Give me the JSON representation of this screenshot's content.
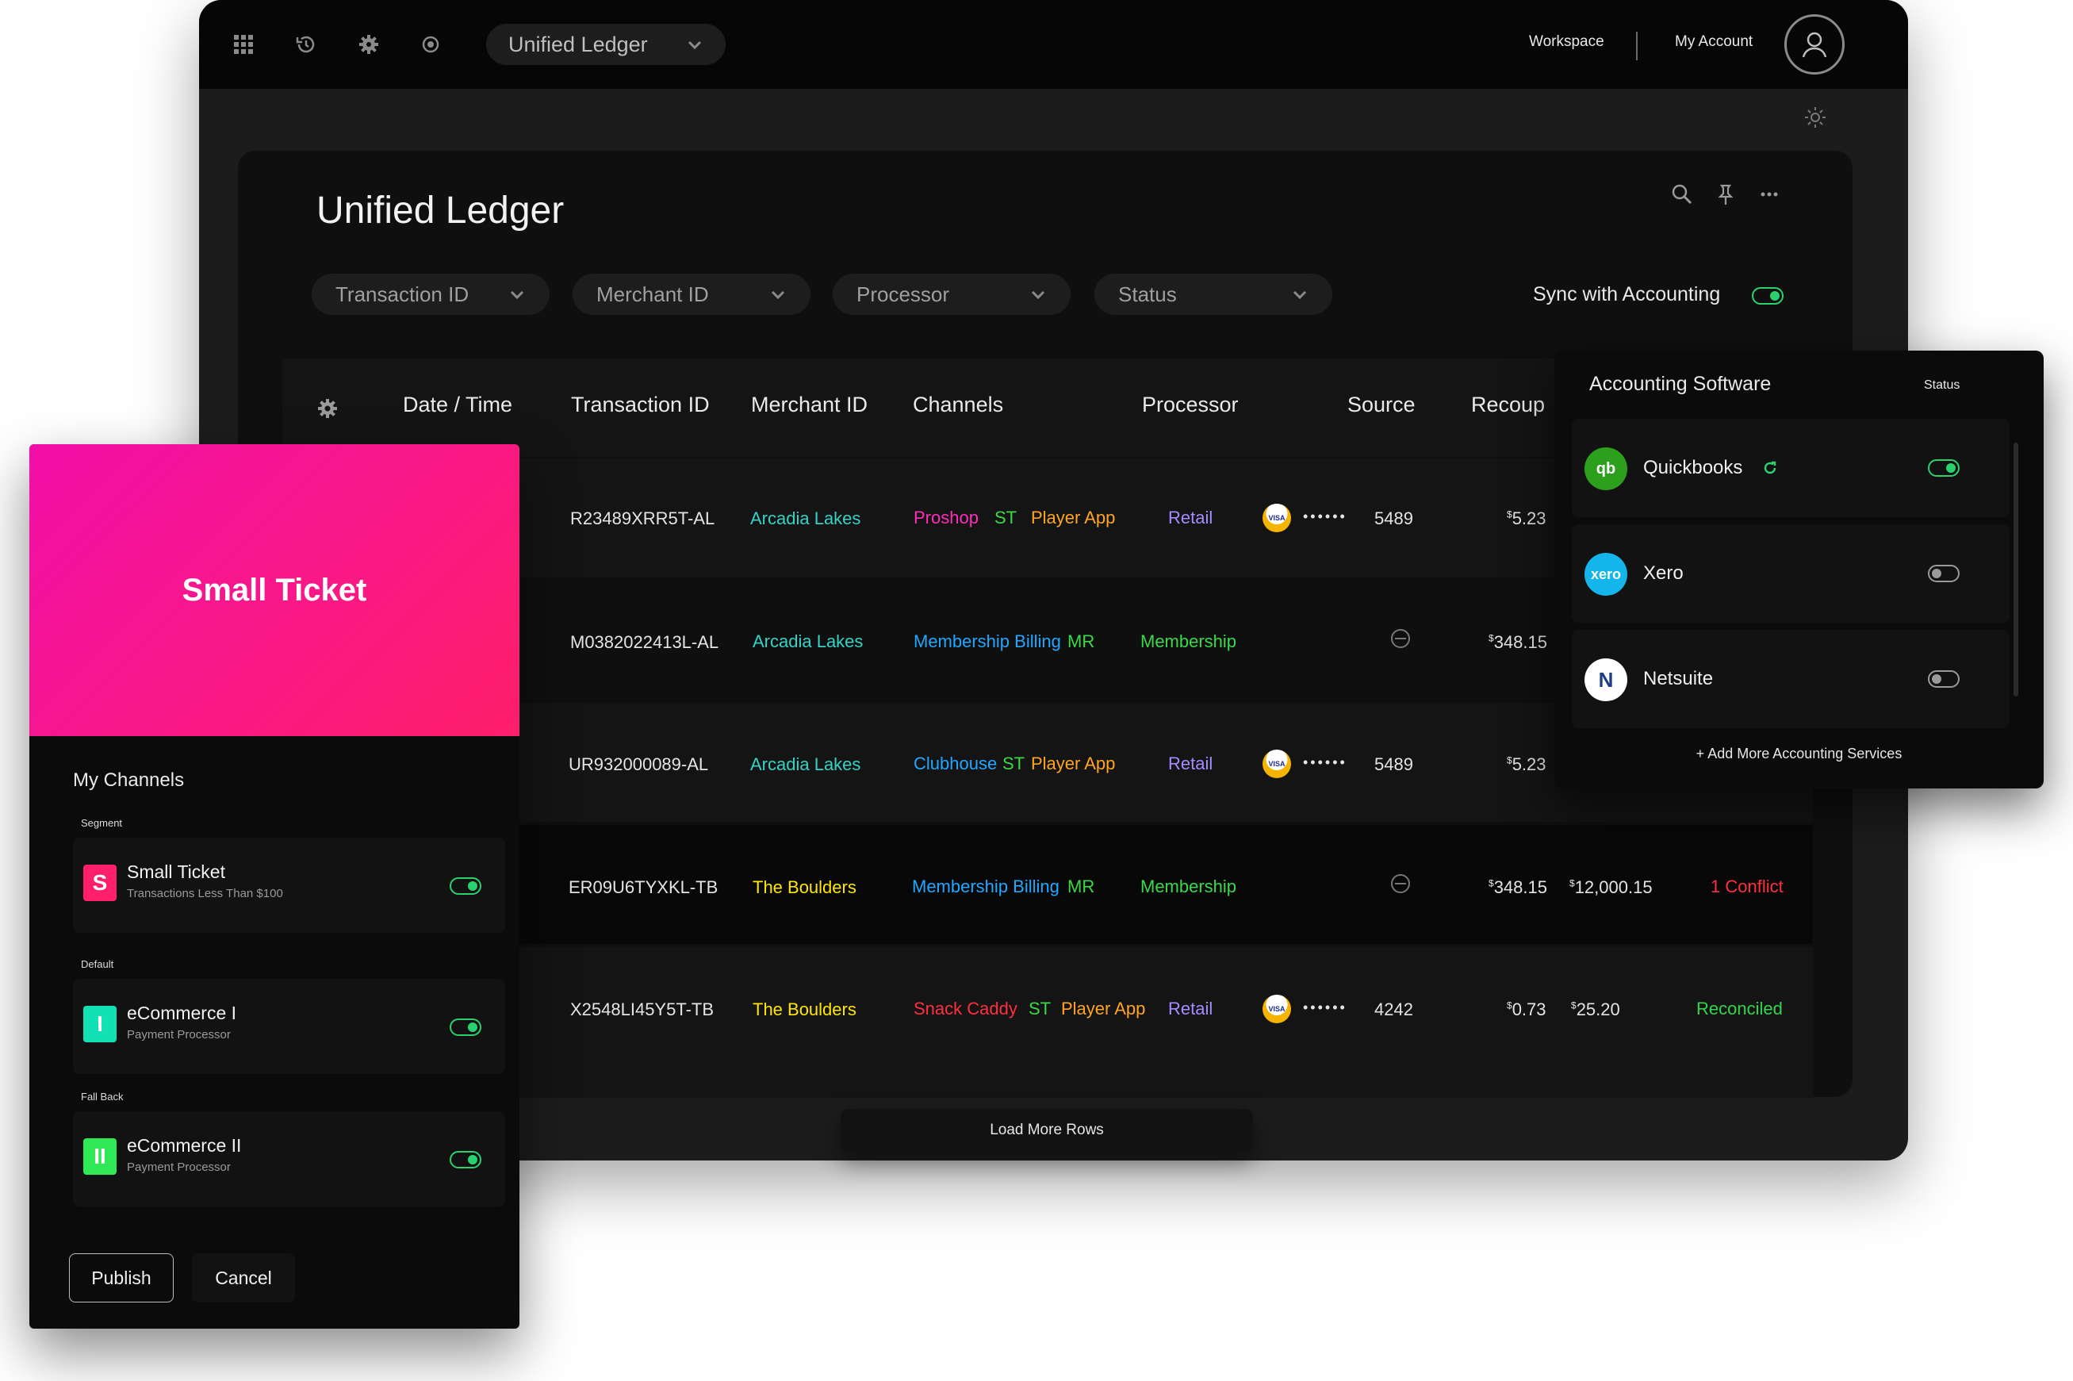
{
  "topbar": {
    "app_name": "Unified Ledger",
    "workspace": "Workspace",
    "account": "My Account"
  },
  "page": {
    "title": "Unified Ledger",
    "filters": [
      "Transaction ID",
      "Merchant ID",
      "Processor",
      "Status"
    ],
    "sync_label": "Sync with Accounting",
    "sync_enabled": true
  },
  "table": {
    "columns": [
      "Date / Time",
      "Transaction ID",
      "Merchant ID",
      "Channels",
      "Processor",
      "Source",
      "Recoup"
    ],
    "rows": [
      {
        "txid": "R23489XRR5T-AL",
        "merchant": "Arcadia Lakes",
        "ch1": "Proshop",
        "ch2": "ST",
        "ch3": "Player App",
        "processor": "Retail",
        "card": "VISA",
        "last4": "5489",
        "recoup": "5.23",
        "amount": "",
        "status": ""
      },
      {
        "txid": "M0382022413L-AL",
        "merchant": "Arcadia Lakes",
        "ch1": "Membership Billing",
        "ch2": "MR",
        "ch3": "",
        "processor": "Membership",
        "card": "",
        "last4": "",
        "recoup": "348.15",
        "amount": "",
        "status": ""
      },
      {
        "txid": "UR932000089-AL",
        "merchant": "Arcadia Lakes",
        "ch1": "Clubhouse",
        "ch2": "ST",
        "ch3": "Player App",
        "processor": "Retail",
        "card": "VISA",
        "last4": "5489",
        "recoup": "5.23",
        "amount": "",
        "status": ""
      },
      {
        "txid": "ER09U6TYXKL-TB",
        "merchant": "The Boulders",
        "ch1": "Membership Billing",
        "ch2": "MR",
        "ch3": "",
        "processor": "Membership",
        "card": "",
        "last4": "",
        "recoup": "348.15",
        "amount": "12,000.15",
        "status": "1 Conflict"
      },
      {
        "txid": "X2548LI45Y5T-TB",
        "merchant": "The Boulders",
        "ch1": "Snack Caddy",
        "ch2": "ST",
        "ch3": "Player App",
        "processor": "Retail",
        "card": "VISA",
        "last4": "4242",
        "recoup": "0.73",
        "amount": "25.20",
        "status": "Reconciled"
      }
    ],
    "currency_symbol": "$",
    "masked": "••••••",
    "load_more": "Load More Rows"
  },
  "accounting": {
    "title": "Accounting Software",
    "status_header": "Status",
    "services": [
      {
        "name": "Quickbooks",
        "logo": "qb",
        "enabled": true,
        "color": "#2ca01c"
      },
      {
        "name": "Xero",
        "logo": "xero",
        "enabled": false,
        "color": "#13b5ea"
      },
      {
        "name": "Netsuite",
        "logo": "N",
        "enabled": false,
        "color": "#ffffff"
      }
    ],
    "add_more": "+ Add More Accounting Services"
  },
  "channels": {
    "hero_title": "Small Ticket",
    "heading": "My Channels",
    "sections": [
      {
        "label": "Segment",
        "name": "Small Ticket",
        "sub": "Transactions Less Than $100",
        "badge": "S",
        "badge_color": "#ff1f6a",
        "enabled": true
      },
      {
        "label": "Default",
        "name": "eCommerce I",
        "sub": "Payment Processor",
        "badge": "I",
        "badge_color": "#12e0b5",
        "enabled": true
      },
      {
        "label": "Fall Back",
        "name": "eCommerce II",
        "sub": "Payment Processor",
        "badge": "II",
        "badge_color": "#2ee856",
        "enabled": true
      }
    ],
    "publish": "Publish",
    "cancel": "Cancel"
  }
}
